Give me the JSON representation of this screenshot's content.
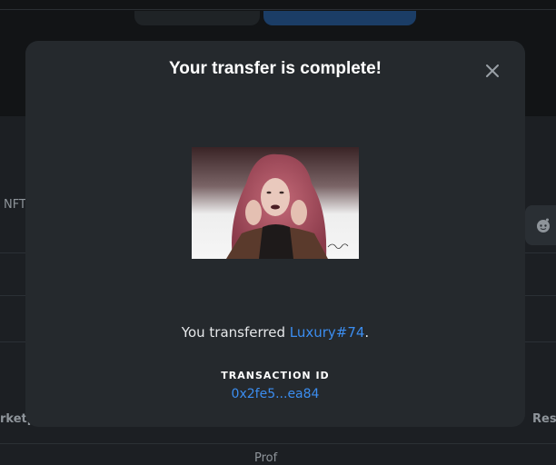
{
  "background": {
    "left_label": "NFT",
    "table_header_left": "rketp",
    "table_header_right": "Res",
    "bottom_left": "",
    "bottom_mid": "Prof"
  },
  "modal": {
    "title": "Your transfer is complete!",
    "close_icon": "close-icon",
    "image_alt": "Luxury#74 NFT artwork",
    "message_prefix": "You transferred ",
    "nft_name": "Luxury#74",
    "message_suffix": ".",
    "tx_label": "TRANSACTION ID",
    "tx_id": "0x2fe5...ea84"
  },
  "colors": {
    "accent": "#3b8df0",
    "modal_bg": "#25292d",
    "page_bg": "#1c1f23"
  }
}
